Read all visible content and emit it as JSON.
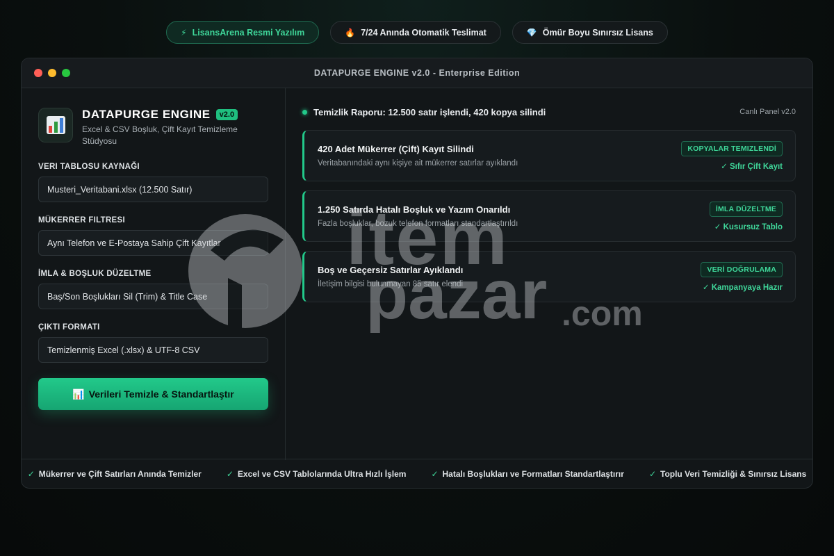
{
  "top_pills": [
    {
      "icon": "⚡",
      "label": "LisansArena Resmi Yazılım"
    },
    {
      "icon": "🔥",
      "label": "7/24 Anında Otomatik Teslimat"
    },
    {
      "icon": "💎",
      "label": "Ömür Boyu Sınırsız Lisans"
    }
  ],
  "window": {
    "title": "DATAPURGE ENGINE v2.0 - Enterprise Edition"
  },
  "brand": {
    "name": "DATAPURGE ENGINE",
    "version": "v2.0",
    "subtitle": "Excel & CSV Boşluk, Çift Kayıt Temizleme Stüdyosu",
    "icon": "bar-chart-icon"
  },
  "form": {
    "fields": [
      {
        "label": "VERI TABLOSU KAYNAĞI",
        "value": "Musteri_Veritabani.xlsx (12.500 Satır)"
      },
      {
        "label": "MÜKERRER FILTRESI",
        "value": "Aynı Telefon ve E-Postaya Sahip Çift Kayıtlar"
      },
      {
        "label": "İMLA & BOŞLUK DÜZELTME",
        "value": "Baş/Son Boşlukları Sil (Trim) & Title Case"
      },
      {
        "label": "ÇIKTI FORMATI",
        "value": "Temizlenmiş Excel (.xlsx) & UTF-8 CSV"
      }
    ],
    "cta_icon": "📊",
    "cta_label": "Verileri Temizle & Standartlaştır"
  },
  "report": {
    "title": "Temizlik Raporu: 12.500 satır işlendi, 420 kopya silindi",
    "panel_label": "Canlı Panel v2.0",
    "cards": [
      {
        "title": "420 Adet Mükerrer (Çift) Kayıt Silindi",
        "desc": "Veritabanındaki aynı kişiye ait mükerrer satırlar ayıklandı",
        "tag": "KOPYALAR TEMIZLENDİ",
        "status": "✓ Sıfır Çift Kayıt"
      },
      {
        "title": "1.250 Satırda Hatalı Boşluk ve Yazım Onarıldı",
        "desc": "Fazla boşluklar, bozuk telefon formatları standartlaştırıldı",
        "tag": "İMLA DÜZELTME",
        "status": "✓ Kusursuz Tablo"
      },
      {
        "title": "Boş ve Geçersiz Satırlar Ayıklandı",
        "desc": "İletişim bilgisi bulunmayan 85 satır elendi",
        "tag": "VERİ DOĞRULAMA",
        "status": "✓ Kampanyaya Hazır"
      }
    ]
  },
  "footer": [
    "Mükerrer ve Çift Satırları Anında Temizler",
    "Excel ve CSV Tablolarında Ultra Hızlı İşlem",
    "Hatalı Boşlukları ve Formatları Standartlaştırır",
    "Toplu Veri Temizliği & Sınırsız Lisans"
  ],
  "watermark": {
    "line1": "item",
    "line2": "pazar",
    "line3": ".com"
  },
  "colors": {
    "accent": "#22c98a",
    "background": "#0a0f0e",
    "panel": "#121618"
  }
}
